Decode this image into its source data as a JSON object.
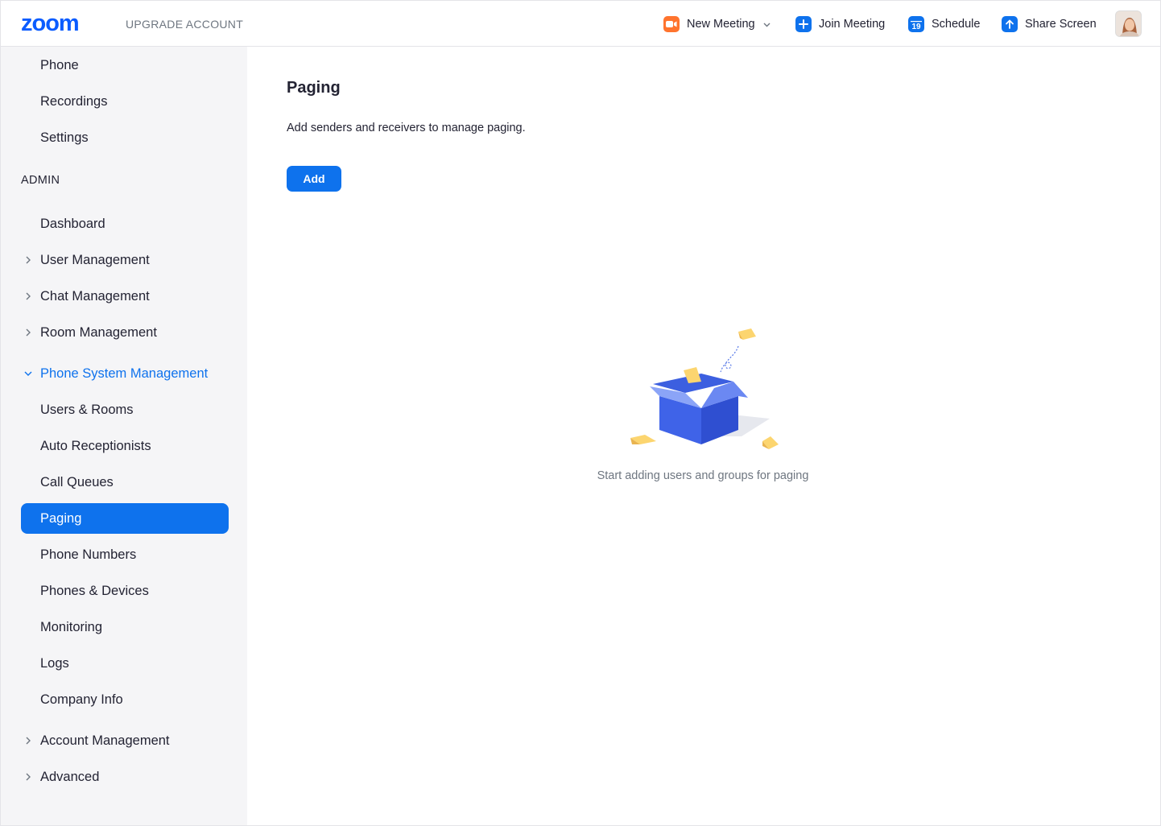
{
  "header": {
    "logo": "zoom",
    "upgrade_label": "UPGRADE ACCOUNT",
    "nav": {
      "new_meeting": "New Meeting",
      "join_meeting": "Join Meeting",
      "schedule": "Schedule",
      "schedule_day": "19",
      "share_screen": "Share Screen"
    }
  },
  "sidebar": {
    "top_items": [
      "Phone",
      "Recordings",
      "Settings"
    ],
    "admin_label": "ADMIN",
    "admin_items": {
      "dashboard": "Dashboard",
      "user_management": "User Management",
      "chat_management": "Chat Management",
      "room_management": "Room Management",
      "phone_system_management": "Phone System Management",
      "account_management": "Account Management",
      "advanced": "Advanced"
    },
    "phone_sub_items": [
      "Users & Rooms",
      "Auto Receptionists",
      "Call Queues",
      "Paging",
      "Phone Numbers",
      "Phones & Devices",
      "Monitoring",
      "Logs",
      "Company Info"
    ]
  },
  "main": {
    "title": "Paging",
    "description": "Add senders and receivers to manage paging.",
    "add_button": "Add",
    "empty_state_text": "Start adding users and groups for paging"
  },
  "colors": {
    "brand": "#0b5cff",
    "accent": "#0e72ed",
    "new_meeting_icon": "#ff742e",
    "sidebar_bg": "#f5f5f7"
  }
}
